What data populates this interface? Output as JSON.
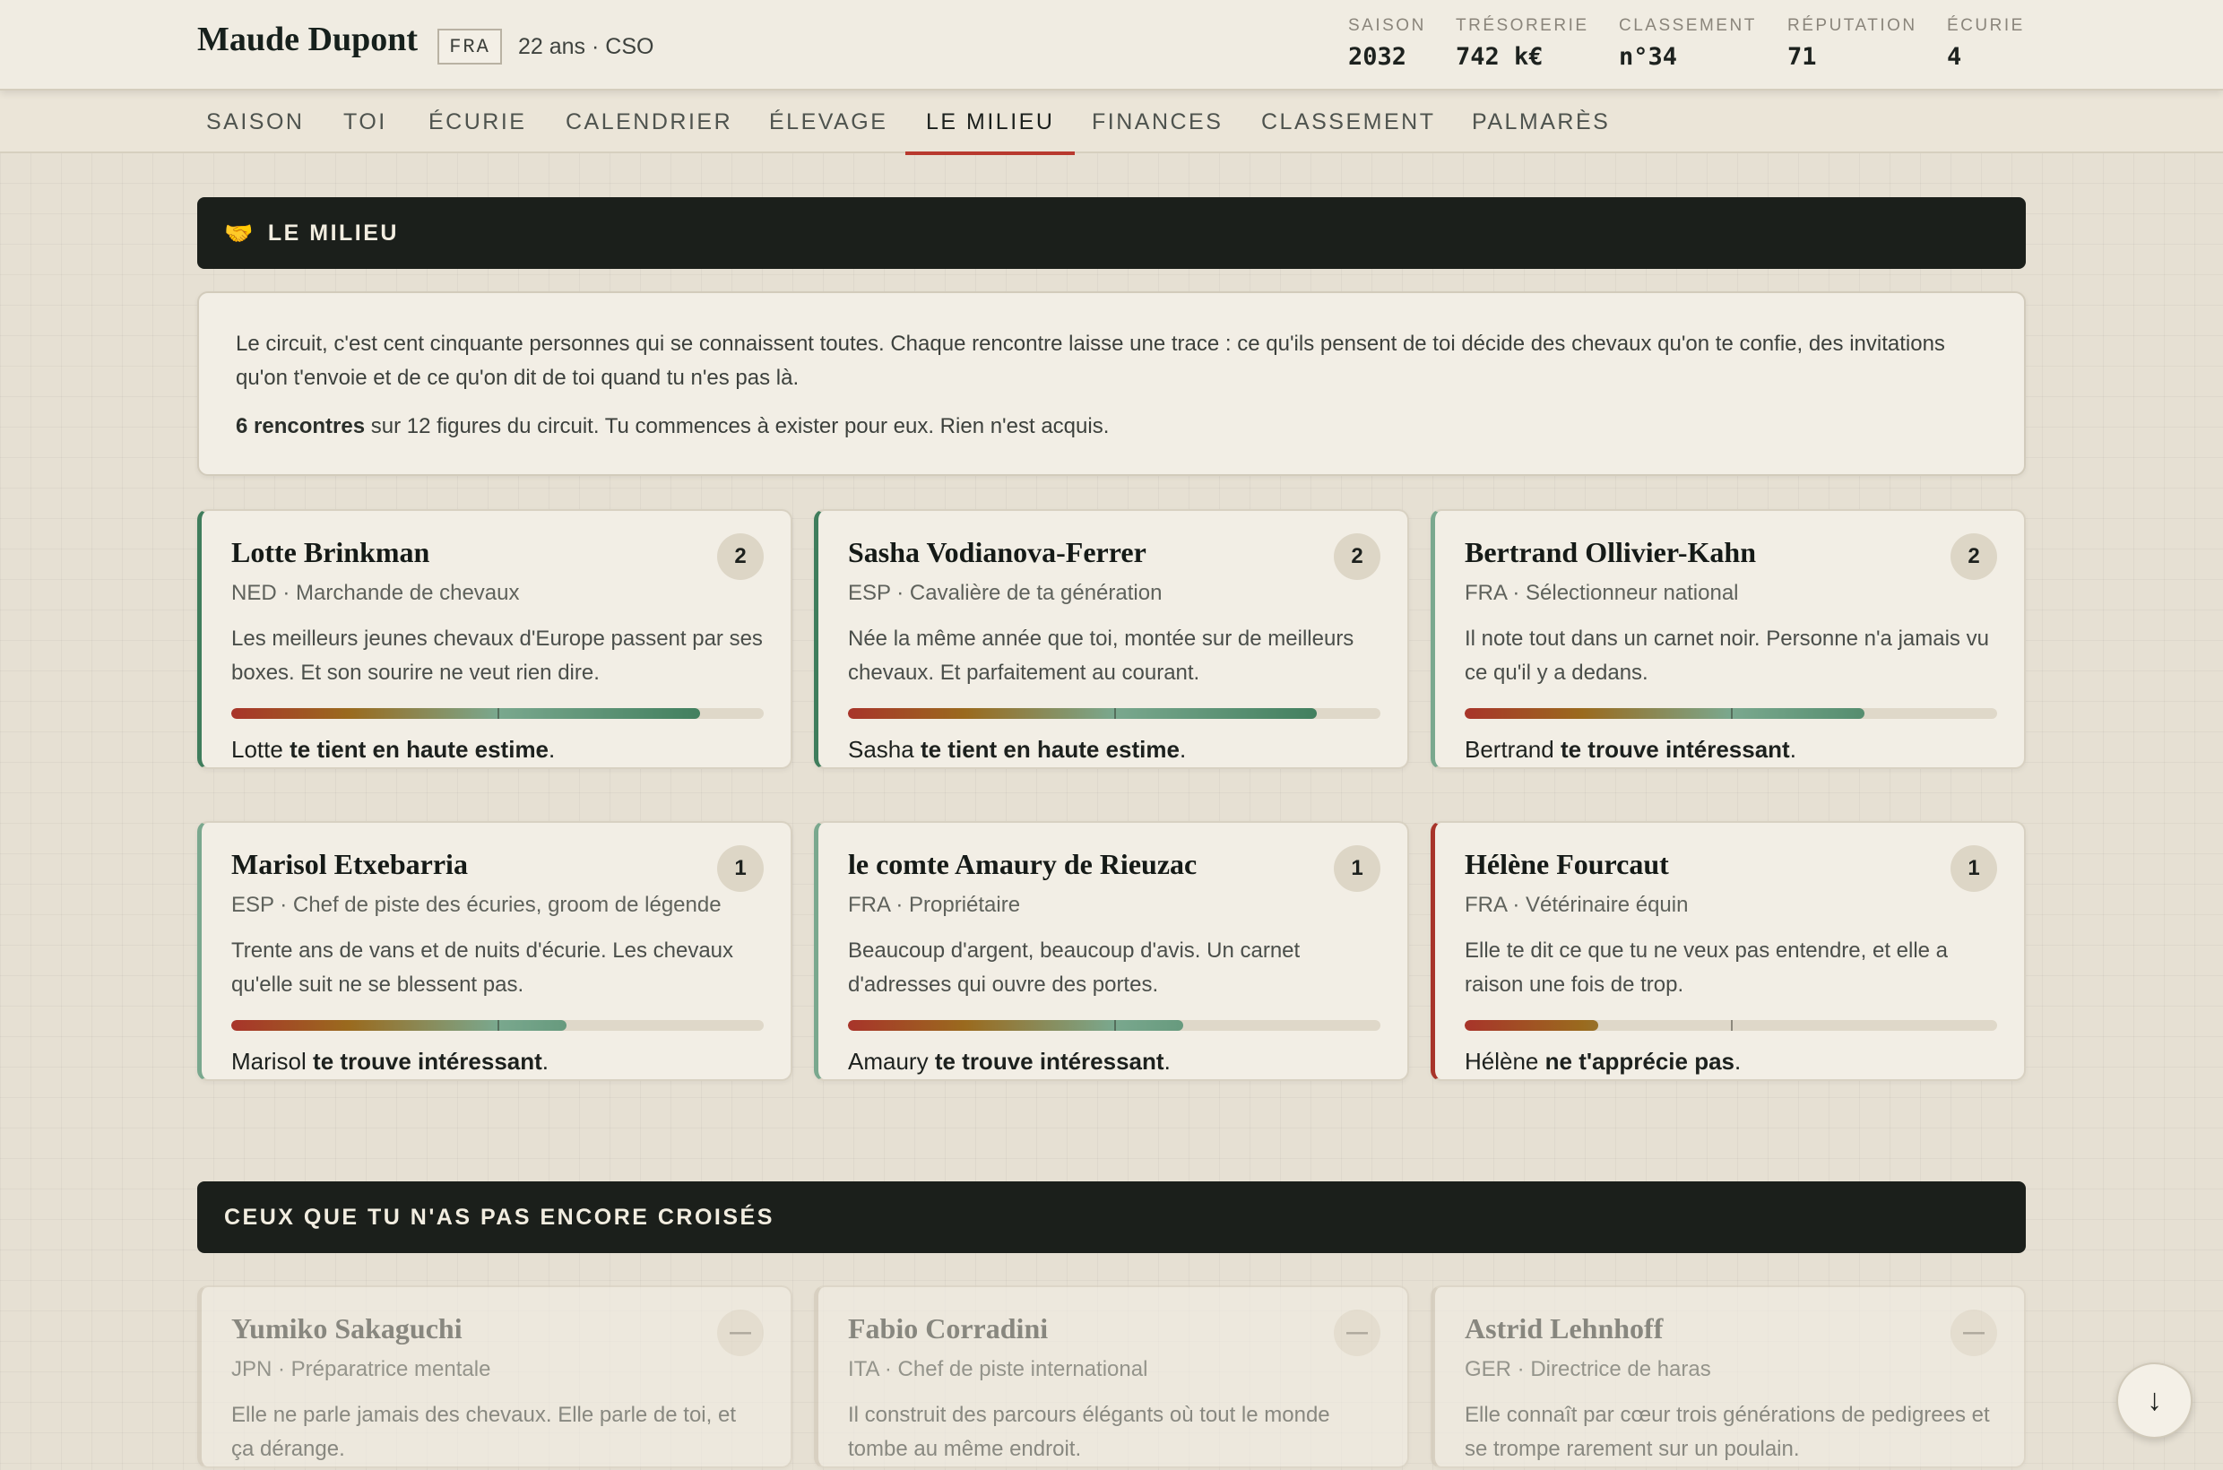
{
  "player": {
    "name": "Maude Dupont",
    "nationality": "FRA",
    "meta": "22 ans · CSO"
  },
  "stats": [
    {
      "label": "SAISON",
      "value": "2032"
    },
    {
      "label": "TRÉSORERIE",
      "value": "742 k€"
    },
    {
      "label": "CLASSEMENT",
      "value": "n°34"
    },
    {
      "label": "RÉPUTATION",
      "value": "71"
    },
    {
      "label": "ÉCURIE",
      "value": "4"
    }
  ],
  "nav": {
    "tabs": [
      "SAISON",
      "TOI",
      "ÉCURIE",
      "CALENDRIER",
      "ÉLEVAGE",
      "LE MILIEU",
      "FINANCES",
      "CLASSEMENT",
      "PALMARÈS"
    ],
    "active": "LE MILIEU"
  },
  "section_milieu": {
    "icon": "handshake-icon",
    "glyph": "🤝",
    "title": "LE MILIEU"
  },
  "intro": {
    "paragraph1": "Le circuit, c'est cent cinquante personnes qui se connaissent toutes. Chaque rencontre laisse une trace : ce qu'ils pensent de toi décide des chevaux qu'on te confie, des invitations qu'on t'envoie et de ce qu'on dit de toi quand tu n'es pas là.",
    "count_bold": "6 rencontres",
    "count_rest": " sur 12 figures du circuit. Tu commences à exister pour eux. Rien n'est acquis."
  },
  "colors": {
    "positive": "#3f7d5c",
    "mid": "#7aa88e",
    "negative": "#a8342a"
  },
  "contacts": [
    {
      "name": "Lotte Brinkman",
      "count": "2",
      "role": "NED · Marchande de chevaux",
      "desc": "Les meilleurs jeunes chevaux d'Europe passent par ses boxes. Et son sourire ne veut rien dire.",
      "opinion_fraction": 0.88,
      "verdict_name": "Lotte",
      "verdict_bold": "te tient en haute estime",
      "verdict_end": ".",
      "accent": "#3f7d5c"
    },
    {
      "name": "Sasha Vodianova-Ferrer",
      "count": "2",
      "role": "ESP · Cavalière de ta génération",
      "desc": "Née la même année que toi, montée sur de meilleurs chevaux. Et parfaitement au courant.",
      "opinion_fraction": 0.88,
      "verdict_name": "Sasha",
      "verdict_bold": "te tient en haute estime",
      "verdict_end": ".",
      "accent": "#3f7d5c"
    },
    {
      "name": "Bertrand Ollivier-Kahn",
      "count": "2",
      "role": "FRA · Sélectionneur national",
      "desc": "Il note tout dans un carnet noir. Personne n'a jamais vu ce qu'il y a dedans.",
      "opinion_fraction": 0.75,
      "verdict_name": "Bertrand",
      "verdict_bold": "te trouve intéressant",
      "verdict_end": ".",
      "accent": "#7aa88e"
    },
    {
      "name": "Marisol Etxebarria",
      "count": "1",
      "role": "ESP · Chef de piste des écuries, groom de légende",
      "desc": "Trente ans de vans et de nuits d'écurie. Les chevaux qu'elle suit ne se blessent pas.",
      "opinion_fraction": 0.63,
      "verdict_name": "Marisol",
      "verdict_bold": "te trouve intéressant",
      "verdict_end": ".",
      "accent": "#7aa88e"
    },
    {
      "name": "le comte Amaury de Rieuzac",
      "count": "1",
      "role": "FRA · Propriétaire",
      "desc": "Beaucoup d'argent, beaucoup d'avis. Un carnet d'adresses qui ouvre des portes.",
      "opinion_fraction": 0.63,
      "verdict_name": "Amaury",
      "verdict_bold": "te trouve intéressant",
      "verdict_end": ".",
      "accent": "#7aa88e"
    },
    {
      "name": "Hélène Fourcaut",
      "count": "1",
      "role": "FRA · Vétérinaire équin",
      "desc": "Elle te dit ce que tu ne veux pas entendre, et elle a raison une fois de trop.",
      "opinion_fraction": 0.25,
      "verdict_name": "Hélène",
      "verdict_bold": "ne t'apprécie pas",
      "verdict_end": ".",
      "accent": "#a8342a"
    }
  ],
  "section_unmet": {
    "title": "CEUX QUE TU N'AS PAS ENCORE CROISÉS"
  },
  "unmet": [
    {
      "name": "Yumiko Sakaguchi",
      "count": "—",
      "role": "JPN · Préparatrice mentale",
      "desc": "Elle ne parle jamais des chevaux. Elle parle de toi, et ça dérange."
    },
    {
      "name": "Fabio Corradini",
      "count": "—",
      "role": "ITA · Chef de piste international",
      "desc": "Il construit des parcours élégants où tout le monde tombe au même endroit."
    },
    {
      "name": "Astrid Lehnhoff",
      "count": "—",
      "role": "GER · Directrice de haras",
      "desc": "Elle connaît par cœur trois générations de pedigrees et se trompe rarement sur un poulain."
    }
  ],
  "scroll_button": {
    "icon": "arrow-down-icon",
    "glyph": "↓"
  }
}
